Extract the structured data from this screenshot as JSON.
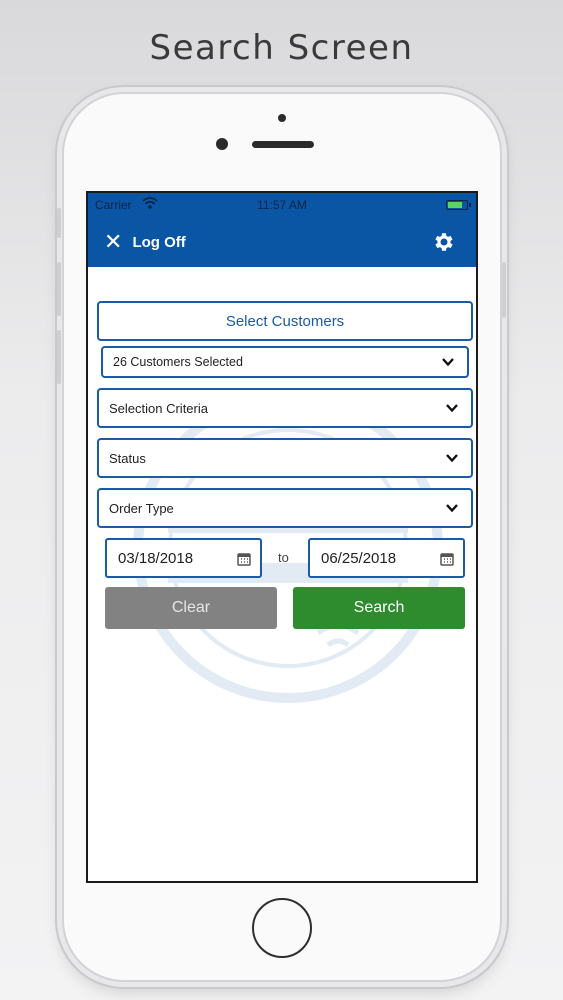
{
  "headline": "Search Screen",
  "status_bar": {
    "carrier": "Carrier",
    "time": "11:57 AM"
  },
  "nav": {
    "logoff_label": "Log Off",
    "icons": [
      "close-icon",
      "gear-icon"
    ]
  },
  "form": {
    "select_customers_label": "Select Customers",
    "customers_selected": "26 Customers Selected",
    "selection_criteria": "Selection Criteria",
    "status": "Status",
    "order_type": "Order Type",
    "date_from": "03/18/2018",
    "date_to_label": "to",
    "date_to": "06/25/2018",
    "clear_label": "Clear",
    "search_label": "Search"
  },
  "colors": {
    "brand_blue": "#0b56a4",
    "search_green": "#2e8b2e",
    "clear_gray": "#828282"
  }
}
